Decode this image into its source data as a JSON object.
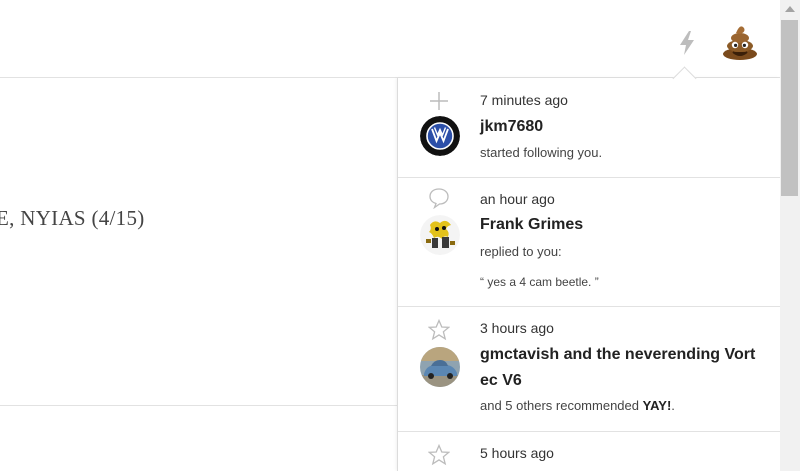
{
  "header": {
    "bolt_icon": "lightning-bolt-icon",
    "user_avatar_icon": "pile-of-poo-emoji-icon"
  },
  "article": {
    "visible_text": "E, NYIAS (4/15)"
  },
  "notifications": [
    {
      "icon": "plus-icon",
      "time": "7 minutes ago",
      "name": "jkm7680",
      "text": "started following you.",
      "avatar": "volkswagen-logo"
    },
    {
      "icon": "speech-bubble-icon",
      "time": "an hour ago",
      "name": "Frank Grimes",
      "text": "replied to you:",
      "quote": "“ yes a 4 cam beetle. ”",
      "avatar": "cartoon-avatar"
    },
    {
      "icon": "star-icon",
      "time": "3 hours ago",
      "name": "gmctavish and the neverending Vortec V6",
      "name_line1": "gmctavish and the neverending Vort",
      "name_line2": "ec V6",
      "text_prefix": "and 5 others recommended ",
      "text_bold": "YAY!",
      "text_suffix": ".",
      "avatar": "car-photo"
    },
    {
      "icon": "star-icon",
      "time": "5 hours ago"
    }
  ],
  "colors": {
    "accent_gray": "#bcbcbc",
    "scrollbar_track": "#f1f1f1",
    "scrollbar_thumb": "#c1c1c1",
    "divider": "#e2e2e2"
  }
}
